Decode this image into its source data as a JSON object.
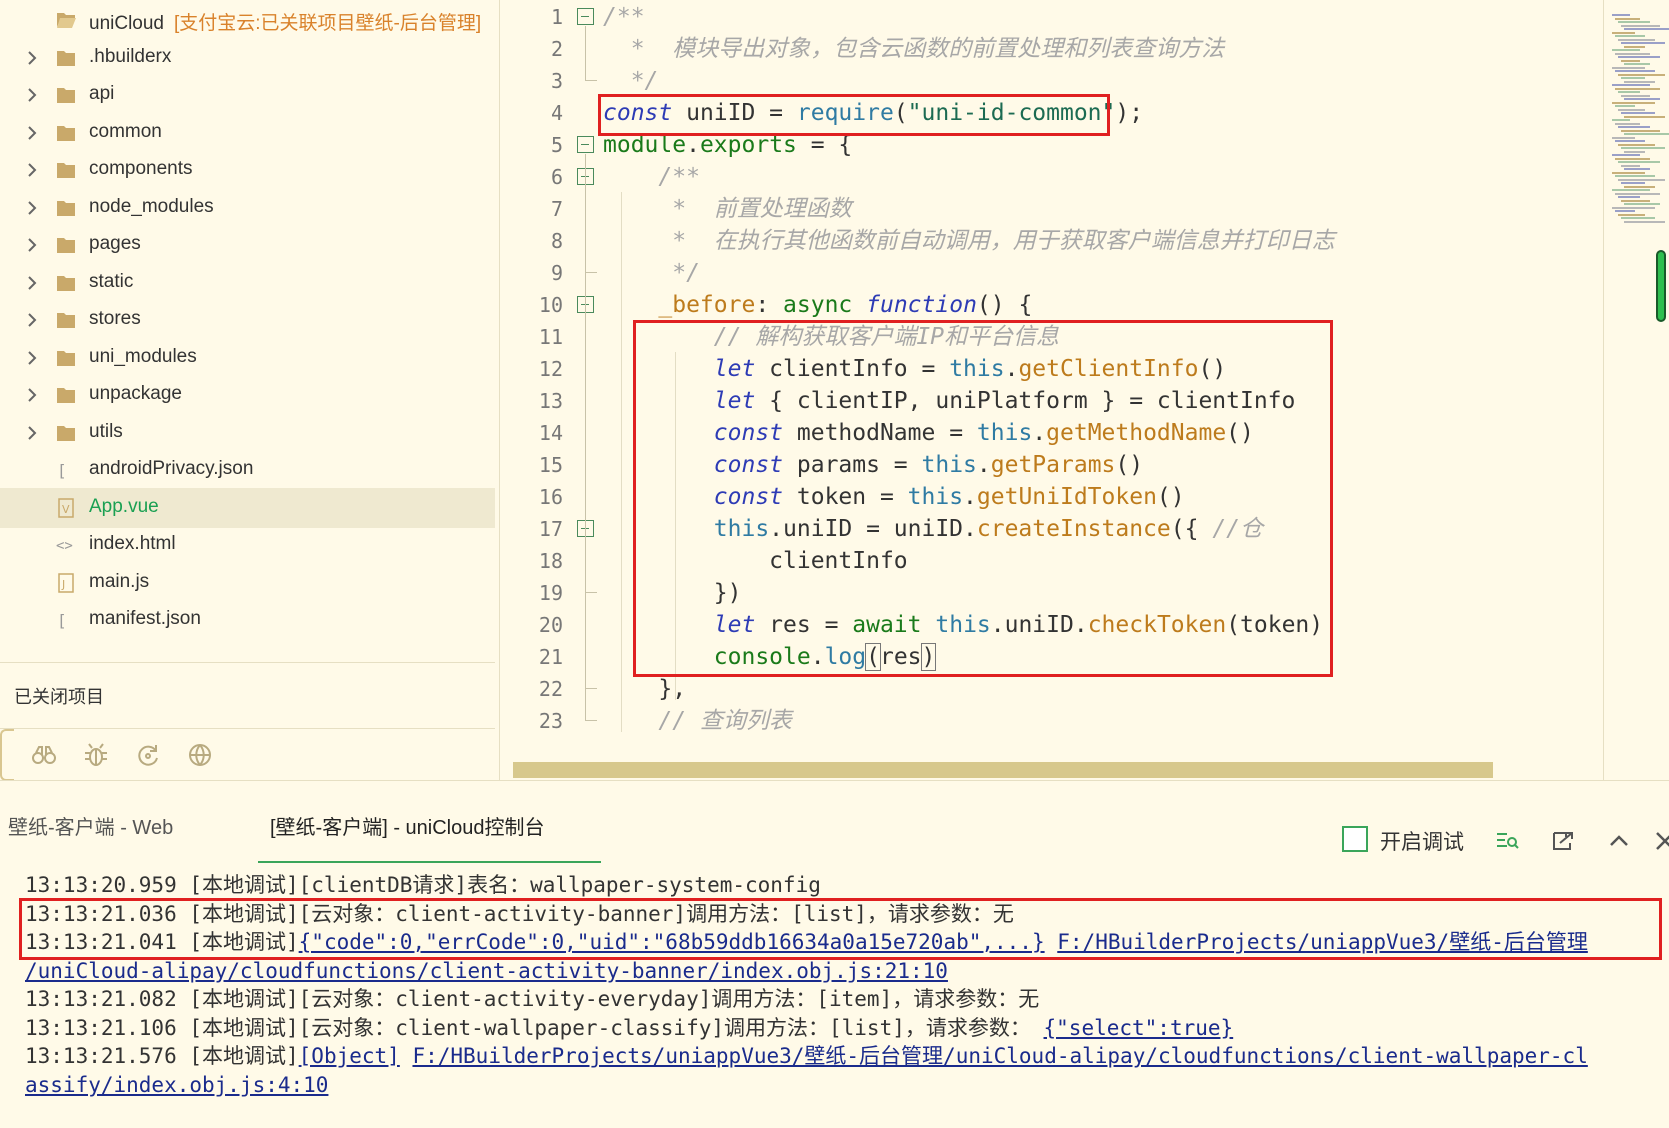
{
  "sidebar": {
    "project": {
      "name": "uniCloud",
      "note": "[支付宝云:已关联项目壁纸-后台管理]"
    },
    "items": [
      {
        "label": ".hbuilderx",
        "type": "folder"
      },
      {
        "label": "api",
        "type": "folder"
      },
      {
        "label": "common",
        "type": "folder"
      },
      {
        "label": "components",
        "type": "folder"
      },
      {
        "label": "node_modules",
        "type": "folder"
      },
      {
        "label": "pages",
        "type": "folder"
      },
      {
        "label": "static",
        "type": "folder"
      },
      {
        "label": "stores",
        "type": "folder"
      },
      {
        "label": "uni_modules",
        "type": "folder"
      },
      {
        "label": "unpackage",
        "type": "folder"
      },
      {
        "label": "utils",
        "type": "folder"
      },
      {
        "label": "androidPrivacy.json",
        "type": "json"
      },
      {
        "label": "App.vue",
        "type": "vue",
        "selected": true
      },
      {
        "label": "index.html",
        "type": "html"
      },
      {
        "label": "main.js",
        "type": "js"
      },
      {
        "label": "manifest.json",
        "type": "json"
      }
    ],
    "closed_projects_label": "已关闭项目",
    "bottom_tools": [
      "binoculars-icon",
      "bug-icon",
      "refresh-icon",
      "globe-icon"
    ]
  },
  "editor": {
    "line_numbers": [
      "1",
      "2",
      "3",
      "4",
      "5",
      "6",
      "7",
      "8",
      "9",
      "10",
      "11",
      "12",
      "13",
      "14",
      "15",
      "16",
      "17",
      "18",
      "19",
      "20",
      "21",
      "22",
      "23"
    ],
    "lines": [
      [
        {
          "t": "/**",
          "c": "cm"
        }
      ],
      [
        {
          "t": "  *  模块导出对象，包含云函数的前置处理和列表查询方法",
          "c": "cm"
        }
      ],
      [
        {
          "t": "  */",
          "c": "cm"
        }
      ],
      [
        {
          "t": "const",
          "c": "kw"
        },
        {
          "t": " uniID = "
        },
        {
          "t": "require",
          "c": "th"
        },
        {
          "t": "("
        },
        {
          "t": "\"uni-id-common\"",
          "c": "str"
        },
        {
          "t": ");"
        }
      ],
      [
        {
          "t": "module",
          "c": "md"
        },
        {
          "t": "."
        },
        {
          "t": "exports",
          "c": "md"
        },
        {
          "t": " = {"
        }
      ],
      [
        {
          "t": "    /**",
          "c": "cm"
        }
      ],
      [
        {
          "t": "     *  前置处理函数",
          "c": "cm"
        }
      ],
      [
        {
          "t": "     *  在执行其他函数前自动调用，用于获取客户端信息并打印日志",
          "c": "cm"
        }
      ],
      [
        {
          "t": "     */",
          "c": "cm"
        }
      ],
      [
        {
          "t": "    "
        },
        {
          "t": "_before",
          "c": "fn"
        },
        {
          "t": ": "
        },
        {
          "t": "async",
          "c": "kwn"
        },
        {
          "t": " "
        },
        {
          "t": "function",
          "c": "kw"
        },
        {
          "t": "() {"
        }
      ],
      [
        {
          "t": "        // 解构获取客户端IP和平台信息",
          "c": "cm"
        }
      ],
      [
        {
          "t": "        "
        },
        {
          "t": "let",
          "c": "kw"
        },
        {
          "t": " clientInfo = "
        },
        {
          "t": "this",
          "c": "th"
        },
        {
          "t": "."
        },
        {
          "t": "getClientInfo",
          "c": "fn"
        },
        {
          "t": "()"
        }
      ],
      [
        {
          "t": "        "
        },
        {
          "t": "let",
          "c": "kw"
        },
        {
          "t": " { clientIP, uniPlatform } = clientInfo"
        }
      ],
      [
        {
          "t": "        "
        },
        {
          "t": "const",
          "c": "kw"
        },
        {
          "t": " methodName = "
        },
        {
          "t": "this",
          "c": "th"
        },
        {
          "t": "."
        },
        {
          "t": "getMethodName",
          "c": "fn"
        },
        {
          "t": "()"
        }
      ],
      [
        {
          "t": "        "
        },
        {
          "t": "const",
          "c": "kw"
        },
        {
          "t": " params = "
        },
        {
          "t": "this",
          "c": "th"
        },
        {
          "t": "."
        },
        {
          "t": "getParams",
          "c": "fn"
        },
        {
          "t": "()"
        }
      ],
      [
        {
          "t": "        "
        },
        {
          "t": "const",
          "c": "kw"
        },
        {
          "t": " token = "
        },
        {
          "t": "this",
          "c": "th"
        },
        {
          "t": "."
        },
        {
          "t": "getUniIdToken",
          "c": "fn"
        },
        {
          "t": "()"
        }
      ],
      [
        {
          "t": "        "
        },
        {
          "t": "this",
          "c": "th"
        },
        {
          "t": ".uniID = uniID."
        },
        {
          "t": "createInstance",
          "c": "fn"
        },
        {
          "t": "({ "
        },
        {
          "t": "//仓",
          "c": "cm"
        }
      ],
      [
        {
          "t": "            clientInfo"
        }
      ],
      [
        {
          "t": "        })"
        }
      ],
      [
        {
          "t": "        "
        },
        {
          "t": "let",
          "c": "kw"
        },
        {
          "t": " res = "
        },
        {
          "t": "await",
          "c": "kwn"
        },
        {
          "t": " "
        },
        {
          "t": "this",
          "c": "th"
        },
        {
          "t": ".uniID."
        },
        {
          "t": "checkToken",
          "c": "fn"
        },
        {
          "t": "(token)"
        }
      ],
      [
        {
          "t": "        "
        },
        {
          "t": "console",
          "c": "md"
        },
        {
          "t": "."
        },
        {
          "t": "log",
          "c": "th"
        },
        {
          "t": "(",
          "c": "brk"
        },
        {
          "t": "res"
        },
        {
          "t": ")",
          "c": "brk"
        }
      ],
      [
        {
          "t": "    },"
        }
      ],
      [
        {
          "t": "    // 查询列表",
          "c": "cm"
        }
      ]
    ]
  },
  "console": {
    "tabs": [
      {
        "label": "壁纸-客户端 - Web",
        "active": false
      },
      {
        "label": "[壁纸-客户端] - uniCloud控制台",
        "active": true
      }
    ],
    "debug_label": "开启调试",
    "header_icons": [
      "filter-list-icon",
      "export-icon",
      "chevron-up-icon",
      "close-icon"
    ],
    "logs": [
      [
        {
          "t": "13:13:20.959 [本地调试][clientDB请求]表名：wallpaper-system-config"
        }
      ],
      [
        {
          "t": "13:13:21.036 [本地调试][云对象：client-activity-banner]调用方法：[list]，请求参数：无"
        }
      ],
      [
        {
          "t": "13:13:21.041 [本地调试]"
        },
        {
          "t": "{\"code\":0,\"errCode\":0,\"uid\":\"68b59ddb16634a0a15e720ab\",...}",
          "c": "lnk"
        },
        {
          "t": " "
        },
        {
          "t": "F:/HBuilderProjects/uniappVue3/壁纸-后台管理",
          "c": "lnk"
        }
      ],
      [
        {
          "t": "/uniCloud-alipay/cloudfunctions/client-activity-banner/index.obj.js:21:10",
          "c": "lnk"
        }
      ],
      [
        {
          "t": "13:13:21.082 [本地调试][云对象：client-activity-everyday]调用方法：[item]，请求参数：无"
        }
      ],
      [
        {
          "t": "13:13:21.106 [本地调试][云对象：client-wallpaper-classify]调用方法：[list]，请求参数： "
        },
        {
          "t": "{\"select\":true}",
          "c": "lnk"
        }
      ],
      [
        {
          "t": "13:13:21.576 [本地调试]"
        },
        {
          "t": "[Object]",
          "c": "lnk"
        },
        {
          "t": " "
        },
        {
          "t": "F:/HBuilderProjects/uniappVue3/壁纸-后台管理/uniCloud-alipay/cloudfunctions/client-wallpaper-cl",
          "c": "lnk"
        }
      ],
      [
        {
          "t": "assify/index.obj.js:4:10",
          "c": "lnk"
        }
      ]
    ]
  },
  "colors": {
    "background": "#fffae8",
    "selected_text": "#1aa052",
    "highlight_border": "#e02020",
    "accent_green": "#3aa55a"
  }
}
